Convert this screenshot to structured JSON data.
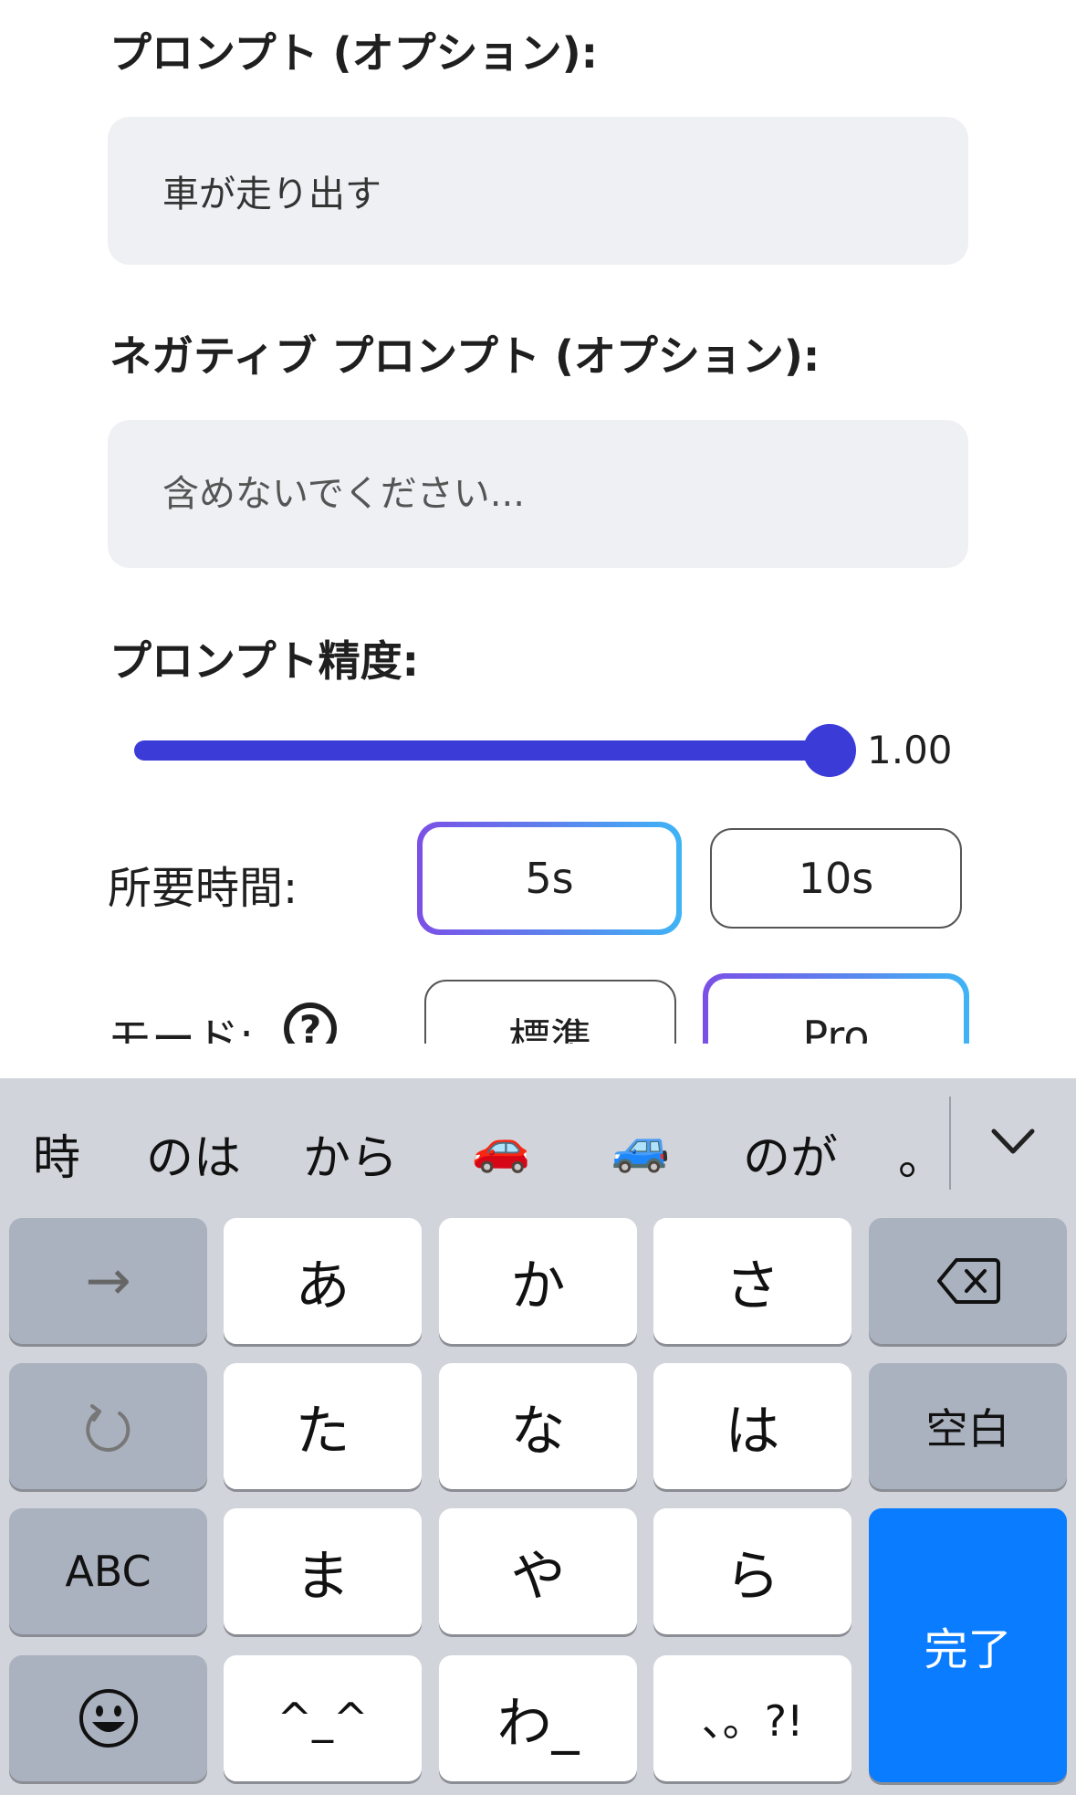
{
  "form": {
    "prompt_label": "プロンプト (オプション):",
    "prompt_value": "車が走り出す",
    "negative_label": "ネガティブ プロンプト (オプション):",
    "negative_placeholder": "含めないでください...",
    "precision_label": "プロンプト精度:",
    "precision_value": "1.00",
    "precision_fraction": 1.0,
    "duration_label": "所要時間:",
    "duration_options": [
      "5s",
      "10s"
    ],
    "duration_selected": "5s",
    "mode_label": "モード:",
    "mode_options": [
      "標準",
      "Pro"
    ],
    "mode_selected": "Pro",
    "help_icon": "question-circle-icon"
  },
  "keyboard": {
    "candidates": [
      "時",
      "のは",
      "から",
      "🚗",
      "🚙",
      "のが",
      "。"
    ],
    "expand_icon": "chevron-down-icon",
    "keys": {
      "next": "→",
      "a": "あ",
      "ka": "か",
      "sa": "さ",
      "delete_icon": "delete-backspace-icon",
      "undo_icon": "undo-icon",
      "ta": "た",
      "na": "な",
      "ha": "は",
      "space": "空白",
      "abc": "ABC",
      "ma": "ま",
      "ya": "や",
      "ra": "ら",
      "done": "完了",
      "emoji_icon": "emoji-icon",
      "kaomoji": "^_^",
      "wa": "わ_",
      "punct": "、。?!"
    }
  },
  "colors": {
    "accent": "#3b3bd8",
    "selected_gradient_start": "#7b4fe6",
    "selected_gradient_end": "#3fb4f5",
    "done_key": "#0a7cff",
    "field_bg": "#eff0f3",
    "keyboard_bg": "#d1d4da"
  }
}
